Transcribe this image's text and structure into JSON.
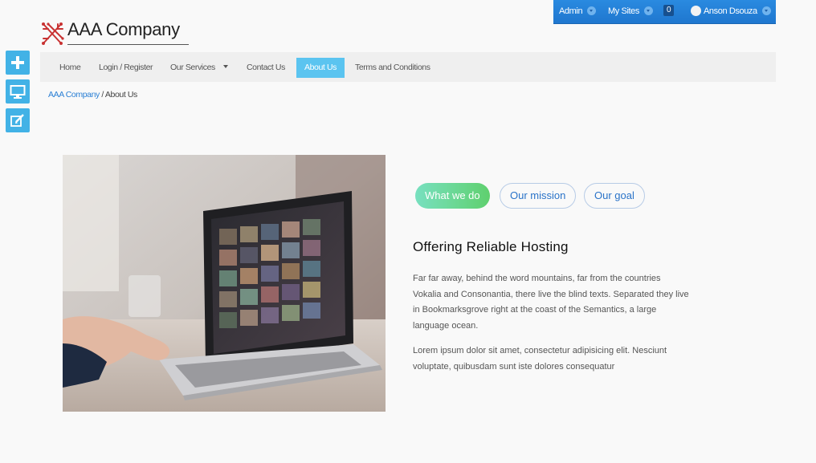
{
  "admin_bar": {
    "admin_label": "Admin",
    "sites_label": "My Sites",
    "notification_count": "0",
    "user_name": "Anson Dsouza"
  },
  "logo": {
    "text": "AAA Company"
  },
  "side_toolbar": {
    "items": [
      {
        "icon": "plus-icon"
      },
      {
        "icon": "desktop-icon"
      },
      {
        "icon": "edit-icon"
      }
    ]
  },
  "nav": {
    "items": [
      {
        "label": "Home"
      },
      {
        "label": "Login / Register"
      },
      {
        "label": "Our Services"
      },
      {
        "label": "Contact Us"
      },
      {
        "label": "About Us",
        "active": true
      },
      {
        "label": "Terms and Conditions"
      }
    ]
  },
  "breadcrumb": {
    "root": "AAA Company",
    "separator": "/",
    "current": "About Us"
  },
  "tabs": [
    {
      "label": "What we do",
      "active": true
    },
    {
      "label": "Our mission",
      "active": false
    },
    {
      "label": "Our goal",
      "active": false
    }
  ],
  "content": {
    "heading": "Offering Reliable Hosting",
    "paragraph1": "Far far away, behind the word mountains, far from the countries Vokalia and Consonantia, there live the blind texts. Separated they live in Bookmarksgrove right at the coast of the Semantics, a large language ocean.",
    "paragraph2": "Lorem ipsum dolor sit amet, consectetur adipisicing elit. Nesciunt voluptate, quibusdam sunt iste dolores consequatur"
  },
  "colors": {
    "admin_bar": "#1f77cf",
    "nav_active": "#5bc4f0",
    "side_button": "#42b2e6",
    "tab_active_start": "#78e0c0",
    "tab_active_end": "#5fd06e",
    "link": "#2a7fd4"
  }
}
